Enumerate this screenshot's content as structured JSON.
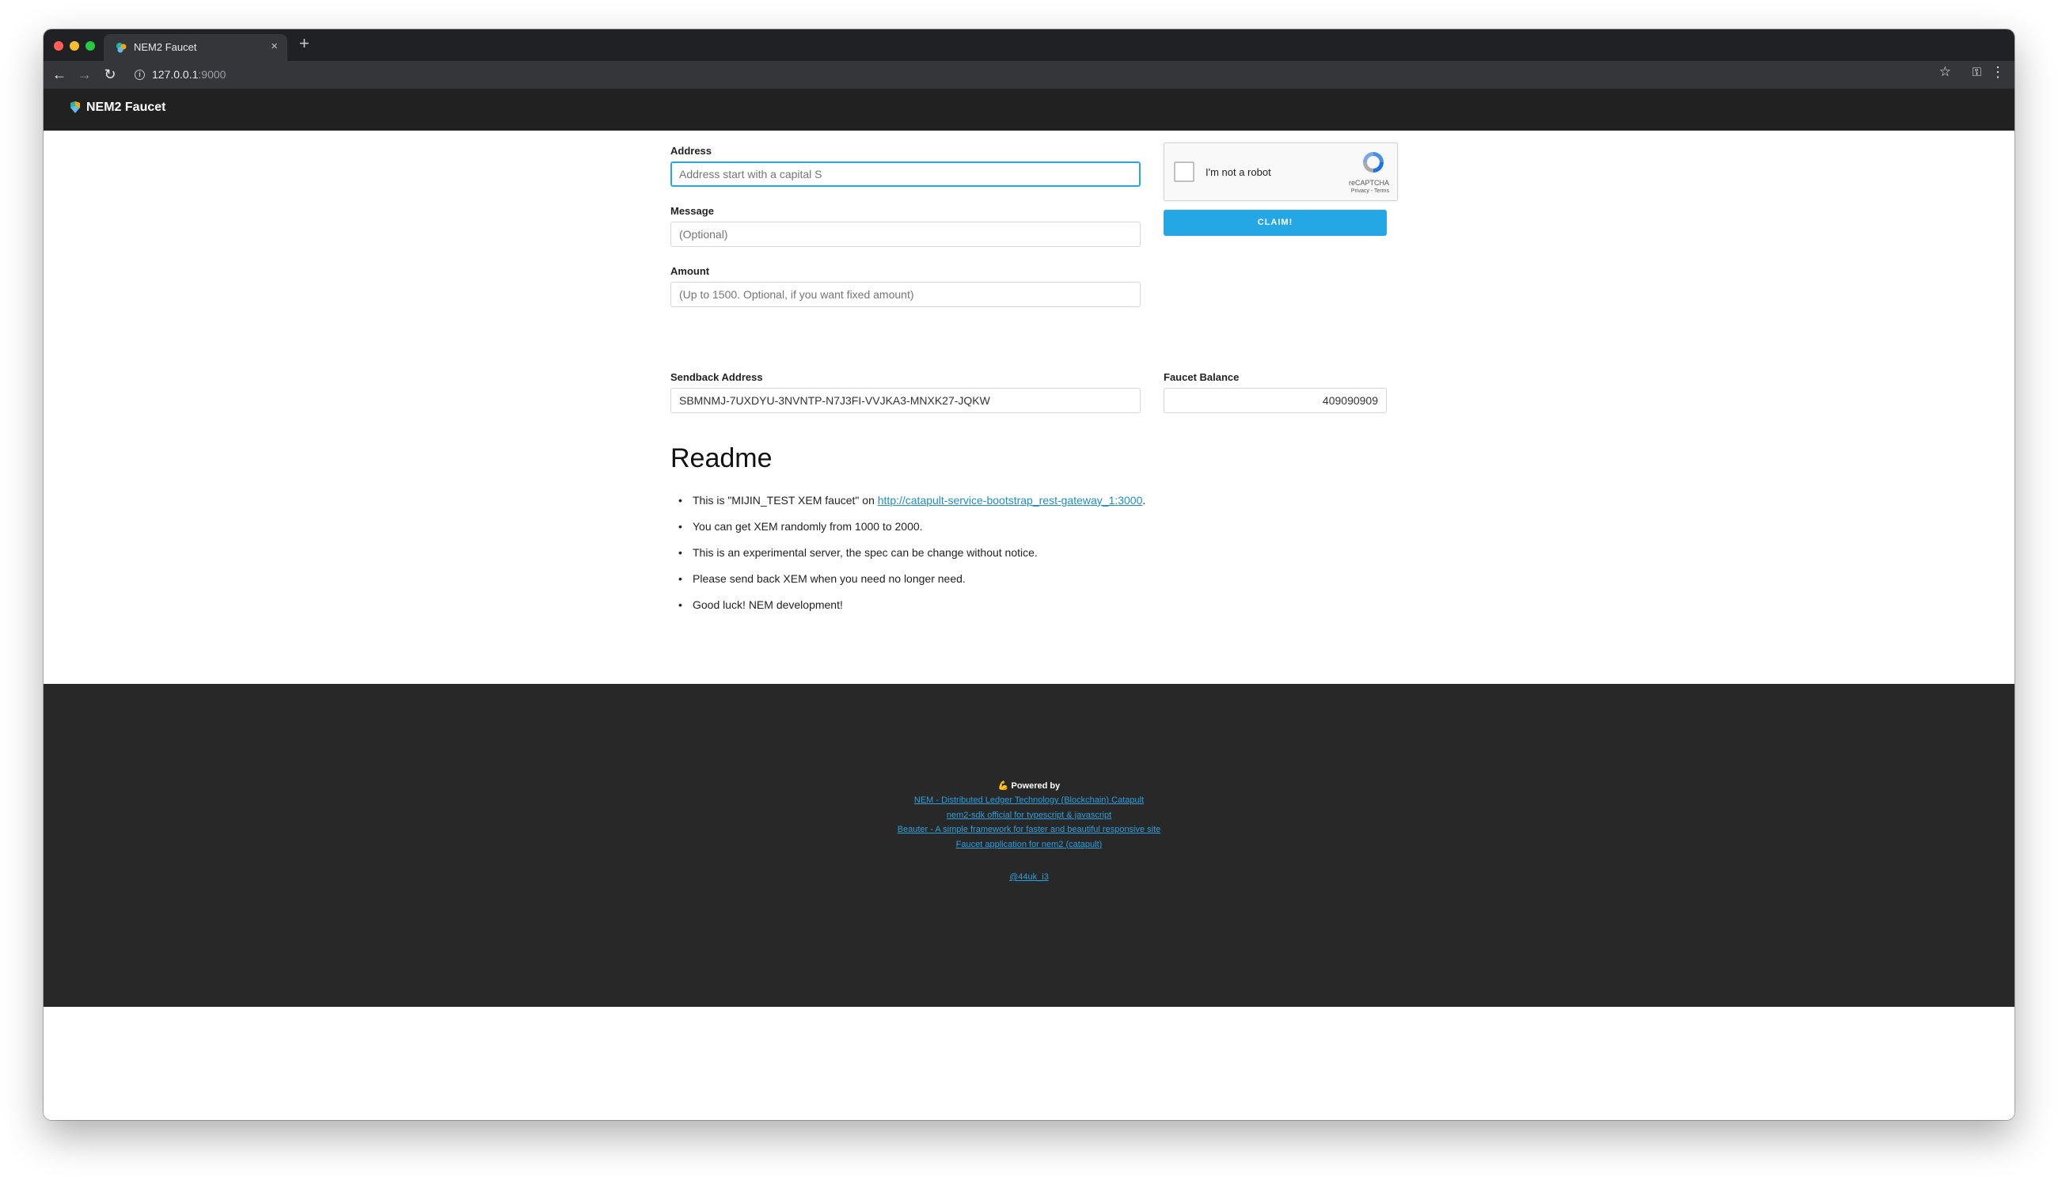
{
  "browser": {
    "tab_title": "NEM2 Faucet",
    "tab_close": "×",
    "new_tab": "+",
    "url_host": "127.0.0.1",
    "url_port": ":9000"
  },
  "navbar": {
    "brand": "NEM2 Faucet"
  },
  "form": {
    "address_label": "Address",
    "address_placeholder": "Address start with a capital S",
    "message_label": "Message",
    "message_placeholder": "(Optional)",
    "amount_label": "Amount",
    "amount_placeholder": "(Up to 1500. Optional, if you want fixed amount)",
    "claim_button": "CLAIM!"
  },
  "recaptcha": {
    "label": "I'm not a robot",
    "brand": "reCAPTCHA",
    "links": "Privacy - Terms"
  },
  "info": {
    "sendback_label": "Sendback Address",
    "sendback_value": "SBMNMJ-7UXDYU-3NVNTP-N7J3FI-VVJKA3-MNXK27-JQKW",
    "balance_label": "Faucet Balance",
    "balance_value": "409090909"
  },
  "readme": {
    "title": "Readme",
    "item1_prefix": "This is \"MIJIN_TEST XEM faucet\" on ",
    "item1_link": "http://catapult-service-bootstrap_rest-gateway_1:3000",
    "item1_suffix": ".",
    "item2": "You can get XEM randomly from 1000 to 2000.",
    "item3": "This is an experimental server, the spec can be change without notice.",
    "item4": "Please send back XEM when you need no longer need.",
    "item5": "Good luck! NEM development!"
  },
  "footer": {
    "powered_by": "💪 Powered by",
    "links": [
      "NEM - Distributed Ledger Technology (Blockchain) Catapult",
      "nem2-sdk official for typescript & javascript",
      "Beauter - A simple framework for faster and beautiful responsive site",
      "Faucet application for nem2 (catapult)"
    ],
    "author": "@44uk_i3"
  },
  "colors": {
    "accent": "#25a7e6",
    "navbar_bg": "#212121",
    "footer_bg": "#282828"
  }
}
